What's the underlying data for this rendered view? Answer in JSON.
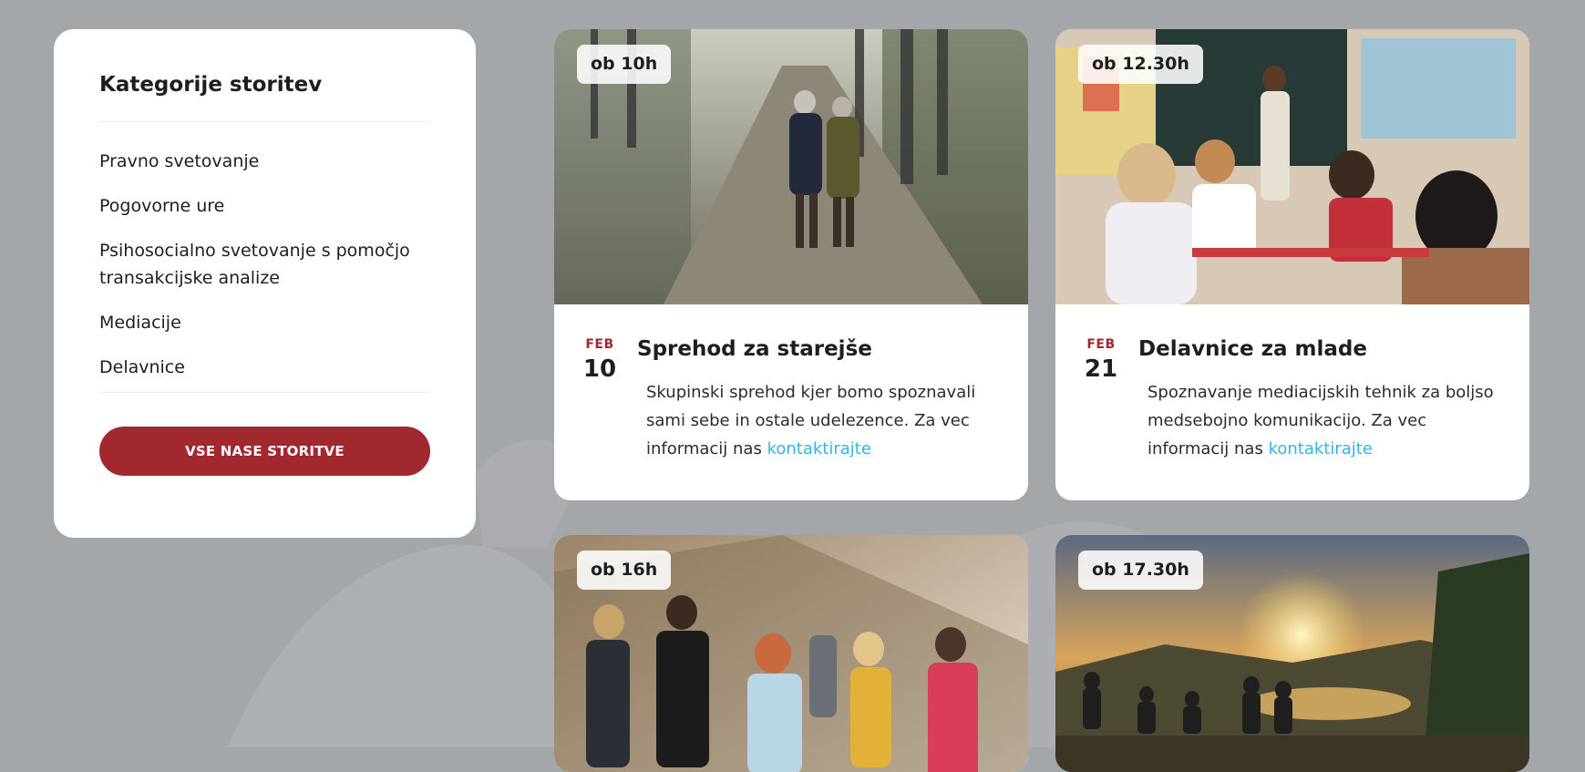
{
  "sidebar": {
    "title": "Kategorije storitev",
    "items": [
      "Pravno svetovanje",
      "Pogovorne ure",
      "Psihosocialno svetovanje s pomočjo transakcijske analize",
      "Mediacije",
      "Delavnice"
    ],
    "button_label": "VSE NASE STORITVE"
  },
  "events": [
    {
      "time": "ob 10h",
      "month": "FEB",
      "day": "10",
      "title": "Sprehod za starejše",
      "desc": "Skupinski sprehod kjer bomo spoznavali sami sebe in ostale udelezence. Za vec informacij nas",
      "link": "kontaktirajte"
    },
    {
      "time": "ob 12.30h",
      "month": "FEB",
      "day": "21",
      "title": "Delavnice za mlade",
      "desc": "Spoznavanje mediacijskih tehnik za boljso medsebojno komunikacijo. Za vec informacij nas",
      "link": "kontaktirajte"
    },
    {
      "time": "ob 16h"
    },
    {
      "time": "ob 17.30h"
    }
  ],
  "colors": {
    "accent": "#a2282f",
    "link": "#2fb6e6",
    "background": "#a4a7aa"
  }
}
